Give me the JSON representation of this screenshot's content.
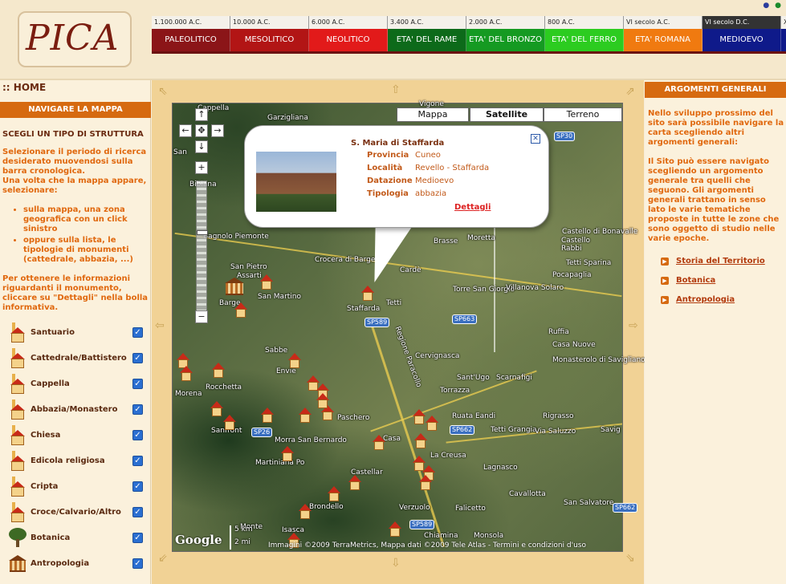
{
  "header": {
    "logo_text": "PICA",
    "flags": [
      "fr-flag",
      "it-flag"
    ]
  },
  "timeline": [
    {
      "date": "1.100.000 A.C.",
      "era": "PALEOLITICO",
      "color": "#8b1518"
    },
    {
      "date": "10.000 A.C.",
      "era": "MESOLITICO",
      "color": "#b21515"
    },
    {
      "date": "6.000 A.C.",
      "era": "NEOLITICO",
      "color": "#e21a1a"
    },
    {
      "date": "3.400 A.C.",
      "era": "ETA' DEL RAME",
      "color": "#0d6a1a"
    },
    {
      "date": "2.000 A.C.",
      "era": "ETA' DEL BRONZO",
      "color": "#159a22"
    },
    {
      "date": "800 A.C.",
      "era": "ETA' DEL FERRO",
      "color": "#2ccc20"
    },
    {
      "date": "VI secolo A.C.",
      "era": "ETA' ROMANA",
      "color": "#f07a10"
    },
    {
      "date": "VI secolo D.C.",
      "era": "MEDIOEVO",
      "color": "#0f1a8a"
    },
    {
      "date": "X",
      "era": "",
      "color": "#0f1a8a"
    }
  ],
  "left": {
    "home": ":: HOME",
    "nav_title": "NAVIGARE LA MAPPA",
    "struct_title": "SCEGLI UN TIPO DI STRUTTURA",
    "instr1": "Selezionare il periodo di ricerca desiderato muovendosi sulla barra cronologica.",
    "instr2": "Una volta che la mappa appare, selezionare:",
    "bullet1": "sulla mappa, una zona geografica con un click sinistro",
    "bullet2": "oppure sulla lista, le tipologie di monumenti (cattedrale, abbazia, ...)",
    "instr3": "Per ottenere le informazioni riguardanti il monumento, cliccare su \"Dettagli\" nella bolla informativa.",
    "categories": [
      {
        "label": "Santuario",
        "icon": "church-icon",
        "checked": true
      },
      {
        "label": "Cattedrale/Battistero",
        "icon": "church-icon",
        "checked": true
      },
      {
        "label": "Cappella",
        "icon": "church-icon",
        "checked": true
      },
      {
        "label": "Abbazia/Monastero",
        "icon": "church-icon",
        "checked": true
      },
      {
        "label": "Chiesa",
        "icon": "church-icon",
        "checked": true
      },
      {
        "label": "Edicola religiosa",
        "icon": "church-icon",
        "checked": true
      },
      {
        "label": "Cripta",
        "icon": "church-icon",
        "checked": true
      },
      {
        "label": "Croce/Calvario/Altro",
        "icon": "church-icon",
        "checked": true
      },
      {
        "label": "Botanica",
        "icon": "tree-icon",
        "checked": true
      },
      {
        "label": "Antropologia",
        "icon": "museum-icon",
        "checked": true
      }
    ]
  },
  "map": {
    "types": [
      "Mappa",
      "Satellite",
      "Terreno"
    ],
    "selected_type": "Satellite",
    "popup": {
      "title": "S. Maria di Staffarda",
      "rows": [
        {
          "key": "Provincia",
          "value": "Cuneo"
        },
        {
          "key": "Località",
          "value": "Revello - Staffarda"
        },
        {
          "key": "Datazione",
          "value": "Medioevo"
        },
        {
          "key": "Tipologia",
          "value": "abbazia"
        }
      ],
      "link": "Dettagli"
    },
    "place_labels": [
      "Vigone",
      "Garzigliana",
      "Cappella",
      "San",
      "Bibiana",
      "Bagnolo Piemonte",
      "San Pietro",
      "Assarti",
      "San Martino",
      "Barge",
      "Crocera di Barge",
      "Brasse",
      "Moretta",
      "Torre San Giorgio",
      "Villanova Solaro",
      "Cardè",
      "Staffarda",
      "Tetti",
      "Ruffia",
      "Casa Nuove",
      "Monasterolo di Savigliano",
      "Cervignasca",
      "Sant'Ugo",
      "Scarnafigi",
      "Torrazza",
      "Sabbe",
      "Envie",
      "Rocchetta",
      "Morena",
      "Sanfront",
      "Paschero",
      "Ruata Eandi",
      "Tetti Grangia",
      "Rigrasso",
      "Via Saluzzo",
      "Savig",
      "Morra San Bernardo",
      "Martiniana Po",
      "Casa",
      "La Creusa",
      "Lagnasco",
      "Castellar",
      "Cavallotta",
      "San Salvatore",
      "Brondello",
      "Verzuolo",
      "Falicetto",
      "Isasca",
      "Chiamina",
      "Monsola",
      "Tetti Sparina",
      "Castello di Bonavalle",
      "Pocapaglia",
      "Castello",
      "Rabbi",
      "Monte"
    ],
    "roads": [
      "SP30",
      "SP589",
      "SP663",
      "SP26",
      "SP662",
      "SP589",
      "SP662"
    ],
    "road_note": "Regione Paracollo",
    "scale_km": "5 km",
    "scale_mi": "2 mi",
    "google": "Google",
    "attribution": "Immagini ©2009 TerraMetrics, Mappa dati ©2009 Tele Atlas - Termini e condizioni d'uso"
  },
  "right": {
    "title": "ARGOMENTI GENERALI",
    "p1": "Nello sviluppo prossimo del sito sarà possibile navigare la carta scegliendo altri argomenti generali:",
    "p2": "Il Sito può essere navigato scegliendo un argomento generale tra quelli che seguono. Gli argomenti generali trattano in senso lato le varie tematiche proposte in tutte le zone che sono oggetto di studio nelle varie epoche.",
    "links": [
      "Storia del Territorio",
      "Botanica",
      "Antropologia"
    ]
  }
}
